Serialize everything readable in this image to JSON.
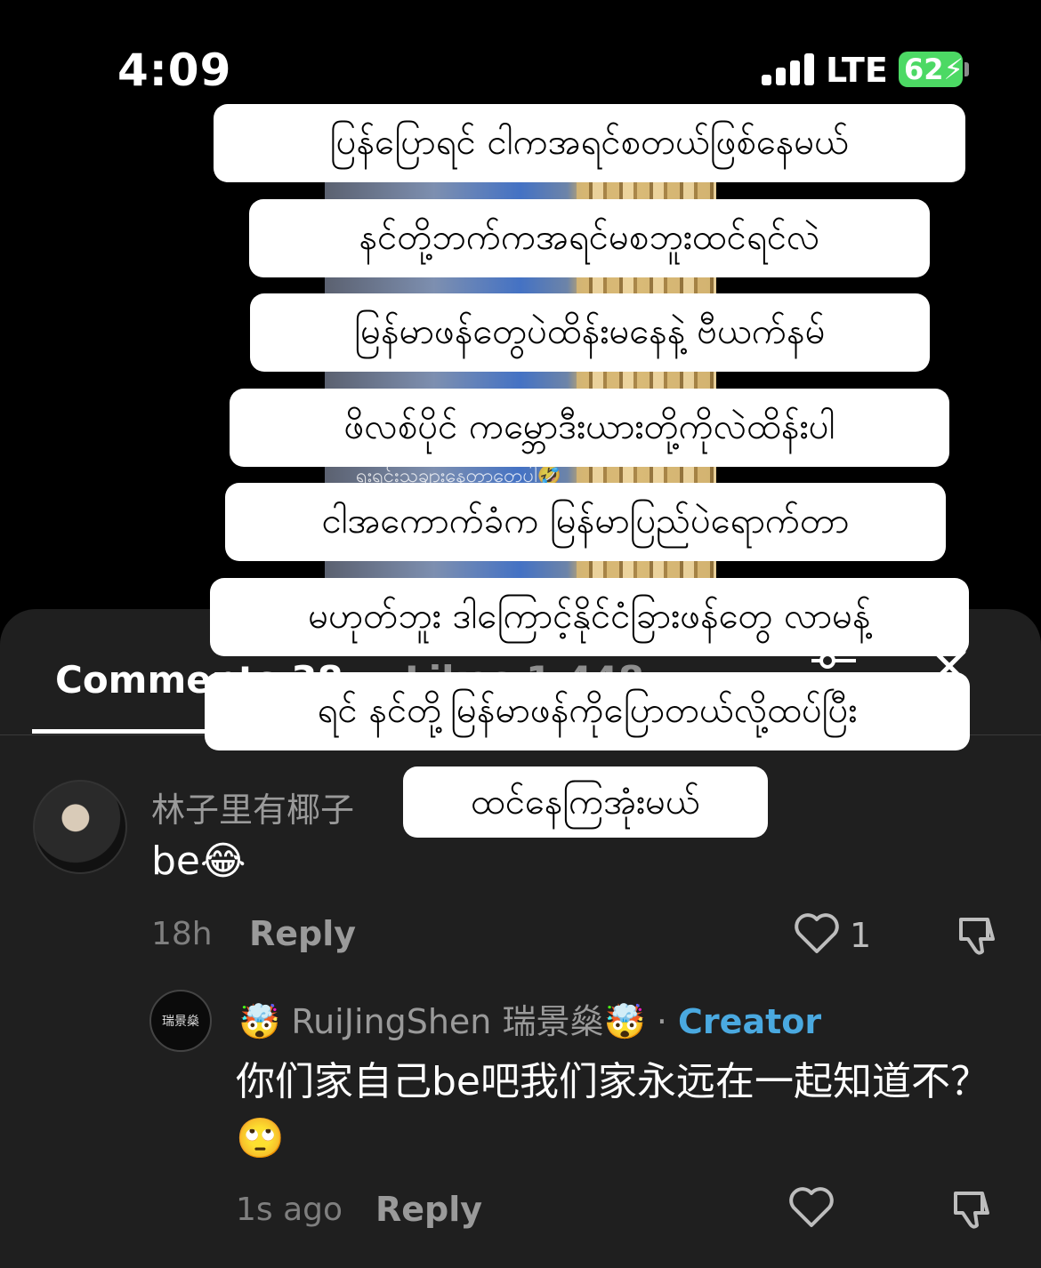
{
  "status_bar": {
    "time": "4:09",
    "network": "LTE",
    "battery": "62"
  },
  "video": {
    "caption_fragment": "ရှူးရှင်းသူချားနေတာတွေပါ🤣"
  },
  "captions": [
    "ပြန်ပြောရင် ငါကအရင်စတယ်ဖြစ်နေမယ်",
    "နင်တို့ဘက်ကအရင်မစဘူးထင်ရင်လဲ",
    "မြန်မာဖန်တွေပဲထိန်းမနေနဲ့ ဗီယက်နမ်",
    "ဖိလစ်ပိုင် ကမ္ဘောဒီးယားတို့ကိုလဲထိန်းပါ",
    "ငါအကောက်ခံက မြန်မာပြည်ပဲရောက်တာ",
    "မဟုတ်ဘူး ဒါကြောင့်နိုင်ငံခြားဖန်တွေ လာမန့်",
    "ရင် နင်တို့မြန်မာဖန်ကိုပြောတယ်လို့ထပ်ပြီး",
    "ထင်နေကြအုံးမယ်"
  ],
  "tabs": {
    "comments": "Comments 38",
    "likes": "Likes 1,448"
  },
  "comments": [
    {
      "username": "林子里有椰子",
      "text": "be😂",
      "time": "18h",
      "reply_label": "Reply",
      "likes": "1"
    },
    {
      "username": "🤯 RuiJingShen 瑞景燊🤯",
      "separator": "·",
      "badge": "Creator",
      "avatar_text": "瑞景燊",
      "text": "你们家自己be吧我们家永远在一起知道不？🙄",
      "time": "1s ago",
      "reply_label": "Reply"
    }
  ],
  "icons": [
    "signal-icon",
    "battery-icon",
    "filter-icon",
    "close-icon",
    "heart-icon",
    "dislike-icon"
  ]
}
